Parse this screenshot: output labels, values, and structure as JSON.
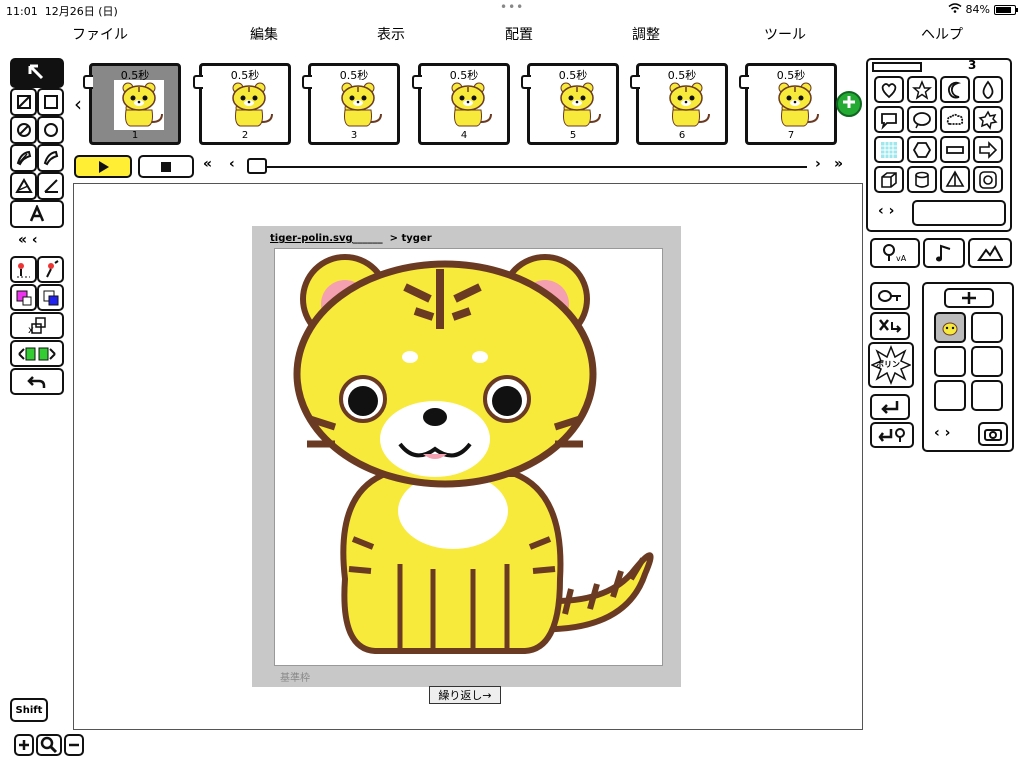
{
  "status": {
    "time": "11:01",
    "date": "12月26日 (日)",
    "battery": "84%",
    "battery_level": 0.84
  },
  "menu": [
    "ファイル",
    "編集",
    "表示",
    "配置",
    "調整",
    "ツール",
    "ヘルプ"
  ],
  "frames": [
    {
      "duration": "0.5秒",
      "number": "1",
      "selected": true
    },
    {
      "duration": "0.5秒",
      "number": "2",
      "selected": false
    },
    {
      "duration": "0.5秒",
      "number": "3",
      "selected": false
    },
    {
      "duration": "0.5秒",
      "number": "4",
      "selected": false
    },
    {
      "duration": "0.5秒",
      "number": "5",
      "selected": false
    },
    {
      "duration": "0.5秒",
      "number": "6",
      "selected": false
    },
    {
      "duration": "0.5秒",
      "number": "7",
      "selected": false
    }
  ],
  "right_panel": {
    "page_number": "3",
    "sticker_label": "ポリン"
  },
  "document": {
    "filename": "tiger-polin.svg",
    "target": "> tyger",
    "footer": "基準枠",
    "repeat_button": "繰り返し→"
  },
  "bottom": {
    "shift_label": "Shift"
  },
  "colors": {
    "play_button": "#ffee33",
    "add_frame": "#22aa33",
    "tiger_body": "#f7ea3a",
    "tiger_stripe": "#6b3a22"
  }
}
